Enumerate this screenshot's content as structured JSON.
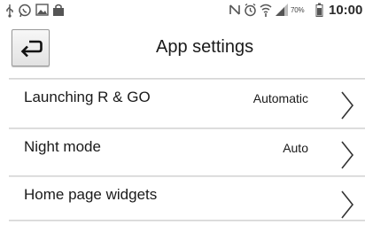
{
  "status_bar": {
    "icons_left": [
      "usb-icon",
      "whatsapp-icon",
      "image-icon",
      "shopping-bag-icon"
    ],
    "icons_right": [
      "nfc-icon",
      "alarm-icon",
      "wifi-icon",
      "signal-icon",
      "battery-icon"
    ],
    "battery_percent": "70%",
    "time": "10:00"
  },
  "header": {
    "title": "App settings",
    "back_icon": "back-arrow-icon"
  },
  "settings": [
    {
      "label": "Launching R & GO",
      "value": "Automatic",
      "icon": "chevron-right-icon"
    },
    {
      "label": "Night mode",
      "value": "Auto",
      "icon": "chevron-right-icon"
    },
    {
      "label": "Home page widgets",
      "value": "",
      "icon": "chevron-right-icon"
    }
  ],
  "colors": {
    "background": "#ffffff",
    "text": "#1a1a1a",
    "divider": "#cfcfcf"
  }
}
